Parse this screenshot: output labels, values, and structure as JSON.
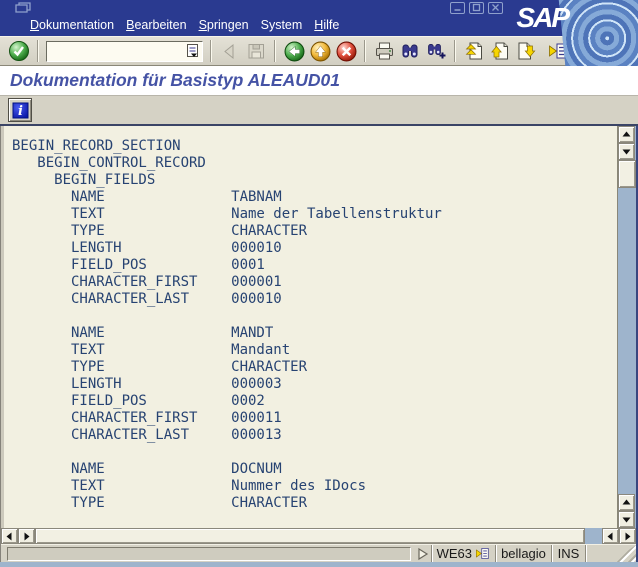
{
  "window": {
    "app": "SAP GUI",
    "controls": [
      "minimize",
      "maximize",
      "close"
    ]
  },
  "brand": {
    "logo_text": "SAP"
  },
  "menu_bar": {
    "items": [
      {
        "label": "Dokumentation",
        "underline_first": true
      },
      {
        "label": "Bearbeiten",
        "underline_first": true
      },
      {
        "label": "Springen",
        "underline_first": true
      },
      {
        "label": "System",
        "underline_first": false
      },
      {
        "label": "Hilfe",
        "underline_first": true
      }
    ]
  },
  "toolbar": {
    "command_field": {
      "value": "",
      "placeholder": ""
    },
    "icons": [
      "enter-check",
      "command-history-list",
      "back-triangle-disabled",
      "save-disabled",
      "back-green-circle",
      "exit-yellow-circle",
      "cancel-red-circle",
      "print",
      "find-binoculars",
      "find-next-binoculars-plus",
      "first-page",
      "page-up",
      "page-down",
      "session-list"
    ]
  },
  "header": {
    "title": "Dokumentation für Basistyp ALEAUD01"
  },
  "app_toolbar": {
    "buttons": [
      "info"
    ]
  },
  "content": {
    "lines": [
      "BEGIN_RECORD_SECTION",
      "   BEGIN_CONTROL_RECORD",
      "     BEGIN_FIELDS",
      "       NAME               TABNAM",
      "       TEXT               Name der Tabellenstruktur",
      "       TYPE               CHARACTER",
      "       LENGTH             000010",
      "       FIELD_POS          0001",
      "       CHARACTER_FIRST    000001",
      "       CHARACTER_LAST     000010",
      "",
      "       NAME               MANDT",
      "       TEXT               Mandant",
      "       TYPE               CHARACTER",
      "       LENGTH             000003",
      "       FIELD_POS          0002",
      "       CHARACTER_FIRST    000011",
      "       CHARACTER_LAST     000013",
      "",
      "       NAME               DOCNUM",
      "       TEXT               Nummer des IDocs",
      "       TYPE               CHARACTER"
    ]
  },
  "status_bar": {
    "message": "",
    "transaction": "WE63",
    "system": "bellagio",
    "mode": "INS"
  },
  "colors": {
    "chrome_navy": "#2A3A90",
    "toolbar_grey": "#D5D2C5",
    "content_bg": "#F2F0E1",
    "content_text": "#274372",
    "title_text": "#4553A5",
    "scroll_track_blue": "#9EB4CC",
    "button_face": "#F0EEE1"
  }
}
